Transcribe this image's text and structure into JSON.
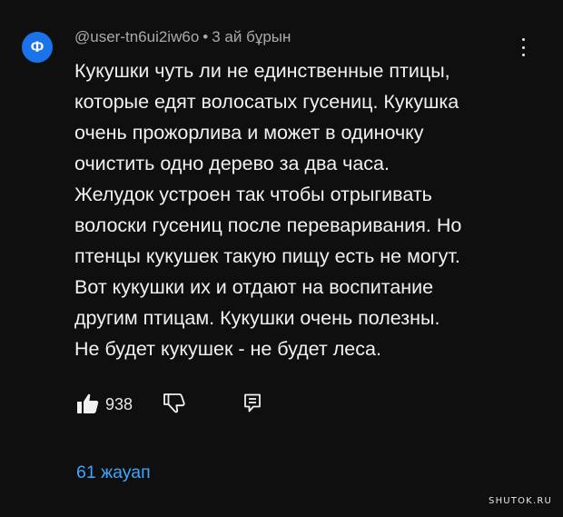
{
  "comment": {
    "avatar_letter": "Ф",
    "avatar_color": "#1a73e8",
    "author": "@user-tn6ui2iw6o",
    "separator": "•",
    "time": "3 ай бұрын",
    "lines": [
      "Кукушки чуть ли не единственные птицы,",
      "которые едят волосатых гусениц. Кукушка",
      "очень прожорлива и может в одиночку",
      "очистить одно дерево за два часа.",
      "Желудок устроен так чтобы отрыгивать",
      "волоски гусениц после переваривания. Но",
      "птенцы кукушек такую пищу есть не могут.",
      "Вот кукушки их и отдают на воспитание",
      "другим птицам. Кукушки очень полезны.",
      "Не будет кукушек - не будет леса."
    ],
    "like_count": "938",
    "replies_label": "61 жауап",
    "link_color": "#3ea6ff"
  },
  "icons": {
    "like": "thumbs-up-icon",
    "dislike": "thumbs-down-icon",
    "reply": "reply-icon",
    "menu": "more-vert-icon"
  },
  "watermark": "SHUTOK.RU"
}
